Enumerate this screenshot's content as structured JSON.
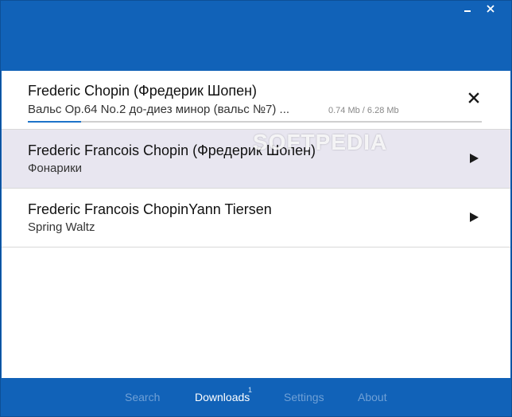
{
  "window": {
    "controls": {
      "minimize_icon": "minimize-icon",
      "close_icon": "close-icon"
    }
  },
  "downloads": [
    {
      "artist": "Frederic Chopin (Фредерик Шопен)",
      "title": "Вальс Op.64 No.2 до-диез минор (вальс №7) ...",
      "size": "0.74 Mb / 6.28 Mb",
      "progress": 0.118,
      "action_icon": "close-icon",
      "highlighted": false
    },
    {
      "artist": "Frederic Francois Chopin (Фредерик Шопен)",
      "title": "Фонарики",
      "action_icon": "play-icon",
      "highlighted": true
    },
    {
      "artist": "Frederic Francois ChopinYann Tiersen",
      "title": "Spring Waltz",
      "action_icon": "play-icon",
      "highlighted": false
    }
  ],
  "watermark": "SOFTPEDIA",
  "nav": {
    "items": [
      "Search",
      "Downloads",
      "Settings",
      "About"
    ],
    "active": "Downloads",
    "downloads_badge": "1"
  },
  "colors": {
    "accent": "#1162b8",
    "progress": "#1d73c9",
    "highlight_row": "#e8e6f0",
    "nav_inactive": "#6fa0d6"
  }
}
